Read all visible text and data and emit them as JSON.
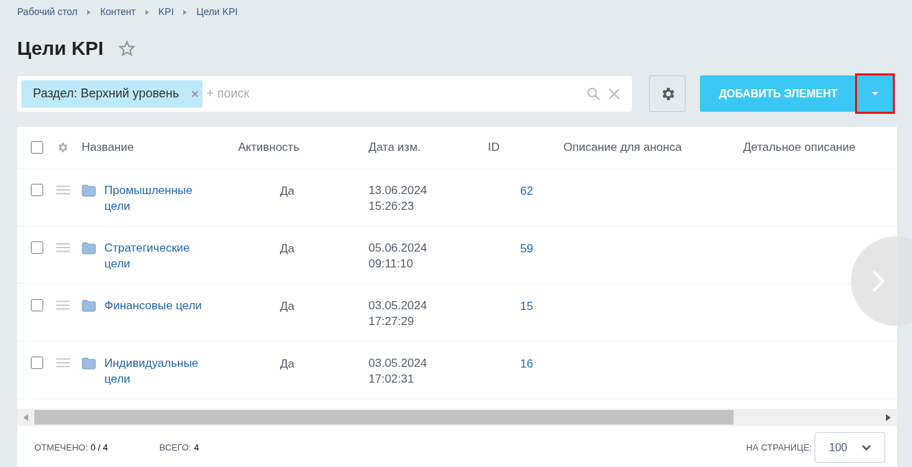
{
  "breadcrumbs": [
    "Рабочий стол",
    "Контент",
    "KPI",
    "Цели KPI"
  ],
  "title": "Цели KPI",
  "favorite": false,
  "filter": {
    "tag": "Раздел: Верхний уровень",
    "placeholder": "+ поиск"
  },
  "add_button": {
    "label": "ДОБАВИТЬ ЭЛЕМЕНТ",
    "dropdown_highlighted": true
  },
  "table": {
    "select_all_checked": false,
    "columns": [
      "Название",
      "Активность",
      "Дата изм.",
      "ID",
      "Описание для анонса",
      "Детальное описание"
    ],
    "rows": [
      {
        "checked": false,
        "name": "Промышленные цели",
        "active": "Да",
        "date": "13.06.2024",
        "time": "15:26:23",
        "id": "62"
      },
      {
        "checked": false,
        "name": "Стратегические цели",
        "active": "Да",
        "date": "05.06.2024",
        "time": "09:11:10",
        "id": "59"
      },
      {
        "checked": false,
        "name": "Финансовые цели",
        "active": "Да",
        "date": "03.05.2024",
        "time": "17:27:29",
        "id": "15"
      },
      {
        "checked": false,
        "name": "Индивидуальные цели",
        "active": "Да",
        "date": "03.05.2024",
        "time": "17:02:31",
        "id": "16"
      }
    ]
  },
  "footer": {
    "selected_label": "ОТМЕЧЕНО:",
    "selected_value": "0 / 4",
    "total_label": "ВСЕГО:",
    "total_value": "4",
    "per_page_label": "НА СТРАНИЦЕ:",
    "per_page": "100"
  }
}
